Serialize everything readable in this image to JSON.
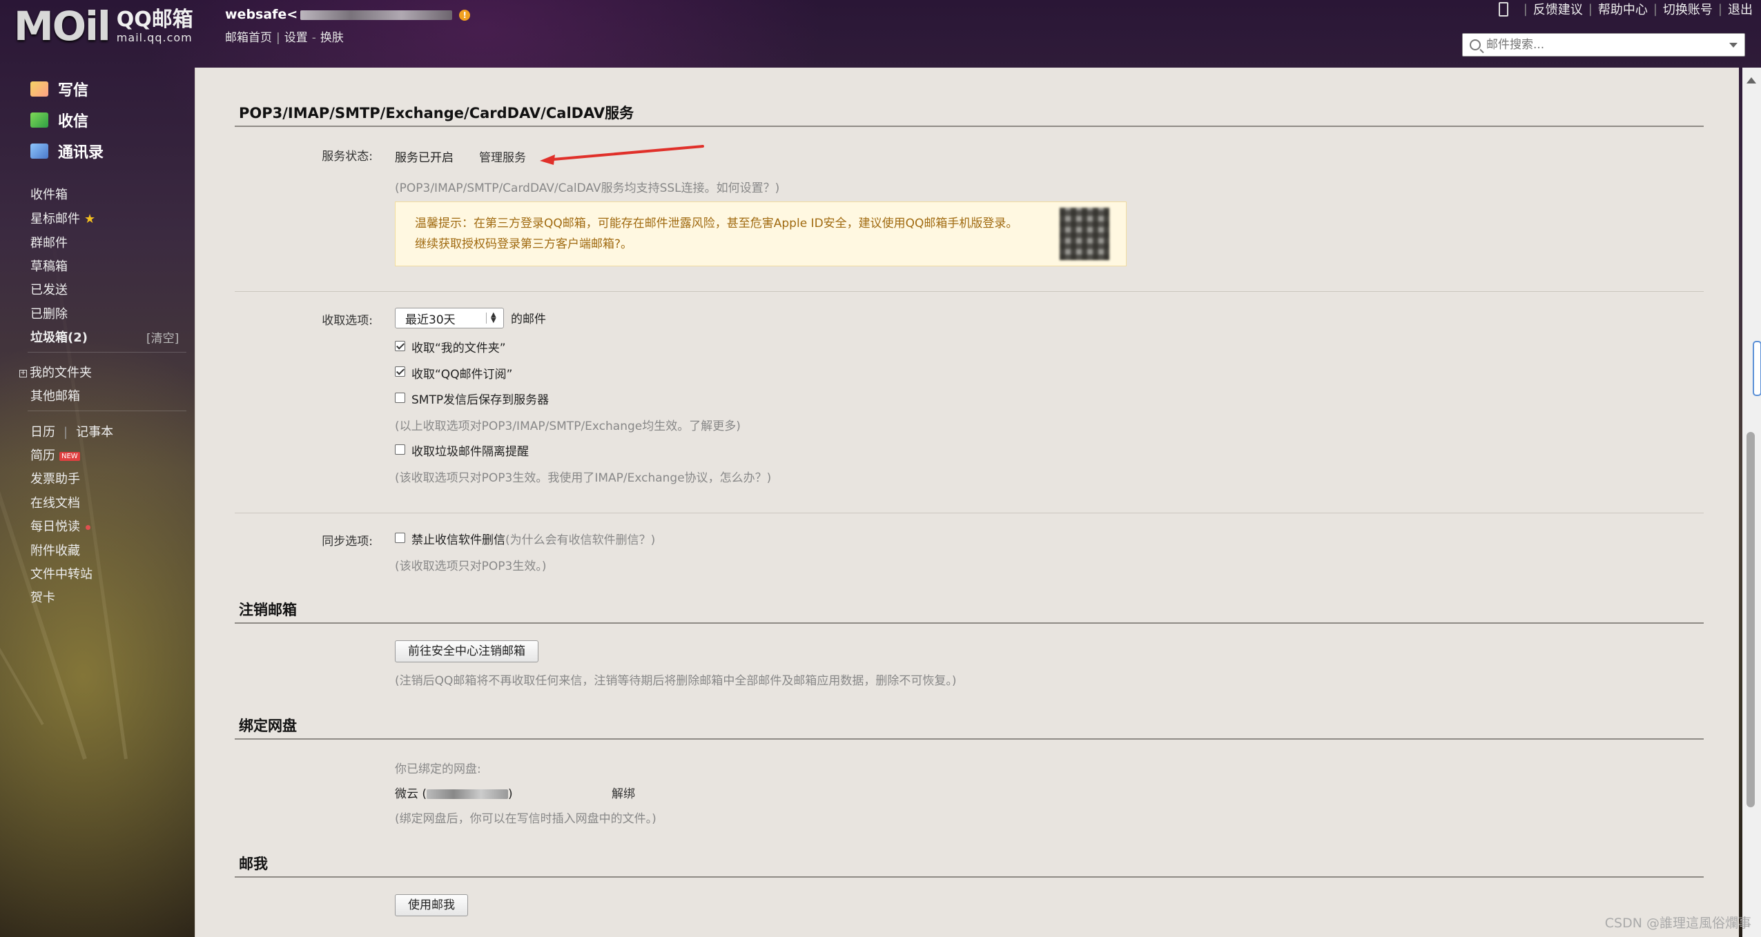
{
  "header": {
    "logo_text": "MOil",
    "brand_cn": "QQ邮箱",
    "brand_en": "mail.qq.com",
    "account_prefix": "websafe<",
    "links": [
      "邮箱首页",
      "设置",
      "换肤"
    ],
    "top_right": [
      "反馈建议",
      "帮助中心",
      "切换账号",
      "退出"
    ],
    "search_placeholder": "邮件搜索..."
  },
  "sidebar": {
    "compose": "写信",
    "inbox_big": "收信",
    "contacts": "通讯录",
    "folders": [
      "收件箱",
      "星标邮件",
      "群邮件",
      "草稿箱",
      "已发送",
      "已删除"
    ],
    "trash": "垃圾箱(2)",
    "clear": "[清空]",
    "my_folders": "我的文件夹",
    "other_mailbox": "其他邮箱",
    "calendar": "日历",
    "notes": "记事本",
    "resume": "简历",
    "new_badge": "NEW",
    "tools": [
      "发票助手",
      "在线文档",
      "每日悦读",
      "附件收藏",
      "文件中转站",
      "贺卡"
    ]
  },
  "content": {
    "pop_title": "POP3/IMAP/SMTP/Exchange/CardDAV/CalDAV服务",
    "service_label": "服务状态:",
    "service_status": "服务已开启",
    "manage_link": "管理服务",
    "ssl_note": "(POP3/IMAP/SMTP/CardDAV/CalDAV服务均支持SSL连接。如何设置？)",
    "tip_line1": "温馨提示：在第三方登录QQ邮箱，可能存在邮件泄露风险，甚至危害Apple ID安全，建议使用QQ邮箱手机版登录。",
    "tip_line2": "继续获取授权码登录第三方客户端邮箱?。",
    "receive_label": "收取选项:",
    "receive_select": "最近30天",
    "receive_suffix": "的邮件",
    "opt_my_folders": "收取“我的文件夹”",
    "opt_subscribe": "收取“QQ邮件订阅”",
    "opt_smtp_save": "SMTP发信后保存到服务器",
    "opt_note1": "(以上收取选项对POP3/IMAP/SMTP/Exchange均生效。了解更多)",
    "opt_spam": "收取垃圾邮件隔离提醒",
    "opt_note2": "(该收取选项只对POP3生效。我使用了IMAP/Exchange协议，怎么办？)",
    "sync_label": "同步选项:",
    "sync_opt": "禁止收信软件删信",
    "sync_why": "(为什么会有收信软件删信？)",
    "sync_note": "(该收取选项只对POP3生效。)",
    "cancel_title": "注销邮箱",
    "cancel_button": "前往安全中心注销邮箱",
    "cancel_note": "(注销后QQ邮箱将不再收取任何来信，注销等待期后将删除邮箱中全部邮件及邮箱应用数据，删除不可恢复。)",
    "disk_title": "绑定网盘",
    "disk_bound": "你已绑定的网盘:",
    "disk_name": "微云 (",
    "disk_close": ")",
    "disk_unbind": "解绑",
    "disk_note": "(绑定网盘后，你可以在写信时插入网盘中的文件。)",
    "me_title": "邮我",
    "me_button": "使用邮我"
  },
  "footer": {
    "watermark": "CSDN @誰理這風俗爛事"
  },
  "checks": {
    "my_folders": true,
    "subscribe": true,
    "smtp_save": false,
    "spam": false,
    "sync": false
  }
}
